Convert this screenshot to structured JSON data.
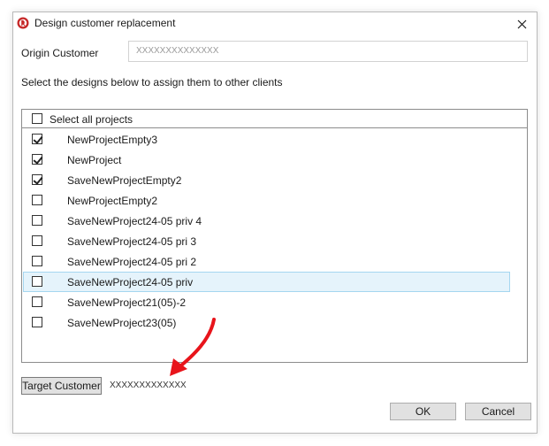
{
  "window": {
    "title": "Design customer replacement",
    "close_glyph": "✕"
  },
  "origin": {
    "label": "Origin Customer",
    "value": "XXXXXXXXXXXXXX"
  },
  "instructions": "Select the designs below to assign them to other clients",
  "project_list": {
    "select_all_label": "Select all projects",
    "select_all_checked": false,
    "items": [
      {
        "label": "NewProjectEmpty3",
        "checked": true,
        "selected": false
      },
      {
        "label": "NewProject",
        "checked": true,
        "selected": false
      },
      {
        "label": "SaveNewProjectEmpty2",
        "checked": true,
        "selected": false
      },
      {
        "label": "NewProjectEmpty2",
        "checked": false,
        "selected": false
      },
      {
        "label": "SaveNewProject24-05 priv 4",
        "checked": false,
        "selected": false
      },
      {
        "label": "SaveNewProject24-05 pri 3",
        "checked": false,
        "selected": false
      },
      {
        "label": "SaveNewProject24-05 pri 2",
        "checked": false,
        "selected": false
      },
      {
        "label": "SaveNewProject24-05 priv",
        "checked": false,
        "selected": true
      },
      {
        "label": "SaveNewProject21(05)-2",
        "checked": false,
        "selected": false
      },
      {
        "label": "SaveNewProject23(05)",
        "checked": false,
        "selected": false
      }
    ]
  },
  "target": {
    "button_label": "Target Customer",
    "value": "XXXXXXXXXXXXX"
  },
  "buttons": {
    "ok_label": "OK",
    "cancel_label": "Cancel"
  },
  "colors": {
    "selection_bg": "#e5f3fb",
    "selection_border": "#a5d6f0",
    "annotation_arrow": "#e8141b",
    "app_icon": "#c62828"
  },
  "icons": {
    "app": "app-logo-icon",
    "close": "close-icon",
    "annotation": "red-arrow-annotation"
  }
}
